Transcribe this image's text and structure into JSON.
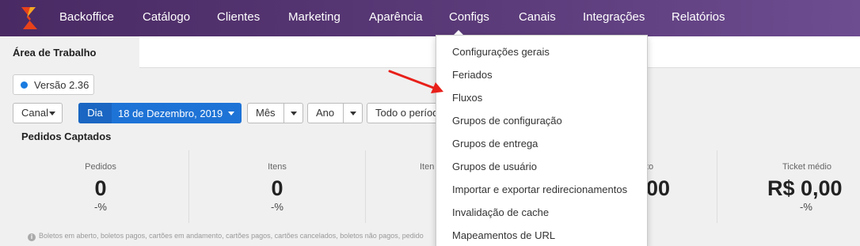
{
  "nav": {
    "logo_icon": "brand-logo-icon",
    "items": [
      "Backoffice",
      "Catálogo",
      "Clientes",
      "Marketing",
      "Aparência",
      "Configs",
      "Canais",
      "Integrações",
      "Relatórios"
    ],
    "active": "Configs"
  },
  "tabs": {
    "active_label": "Área de Trabalho"
  },
  "version": {
    "label": "Versão 2.36",
    "dot_color": "#1a7be0"
  },
  "filters": {
    "canal": "Canal",
    "dia": "Dia",
    "date": "18 de Dezembro, 2019",
    "mes": "Mês",
    "ano": "Ano",
    "todo": "Todo o períod"
  },
  "section": {
    "title": "Pedidos Captados"
  },
  "metrics": [
    {
      "label": "Pedidos",
      "value": "0",
      "pct": "-%"
    },
    {
      "label": "Itens",
      "value": "0",
      "pct": "-%"
    },
    {
      "label": "Iten",
      "value": "",
      "pct": ""
    },
    {
      "label": "to",
      "value": "00",
      "pct": ""
    },
    {
      "label": "Ticket médio",
      "value": "R$ 0,00",
      "pct": "-%"
    }
  ],
  "footnote": "Boletos em aberto, boletos pagos, cartões em andamento, cartões pagos, cartões cancelados, boletos não pagos, pedido",
  "dropdown": {
    "items": [
      "Configurações gerais",
      "Feriados",
      "Fluxos",
      "Grupos de configuração",
      "Grupos de entrega",
      "Grupos de usuário",
      "Importar e exportar redirecionamentos",
      "Invalidação de cache",
      "Mapeamentos de URL"
    ]
  },
  "colors": {
    "nav_bg": "#4a2a63",
    "accent_blue": "#1e73d6",
    "annotation_arrow": "#e8201a"
  }
}
